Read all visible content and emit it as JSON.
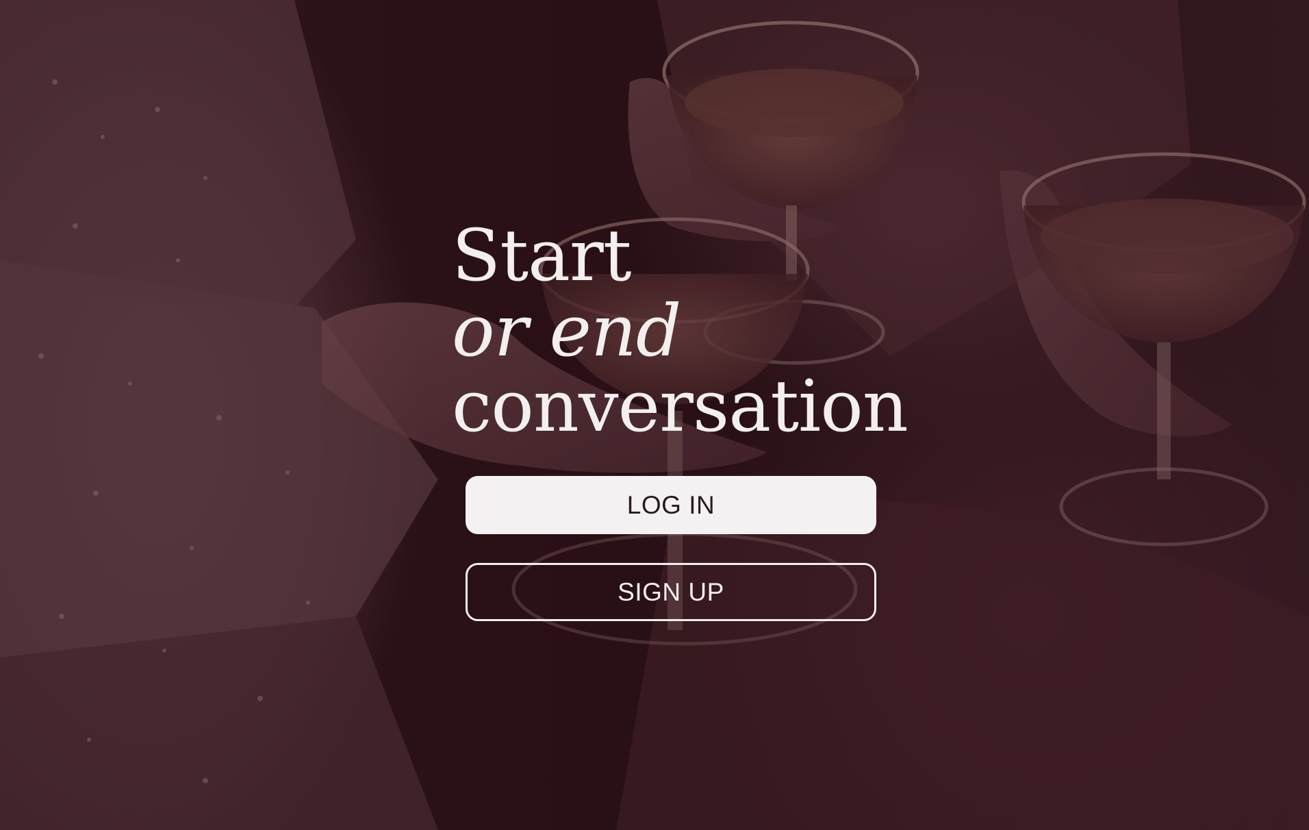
{
  "headline": {
    "line1": "Start",
    "line2": "or end",
    "line3": "conversation"
  },
  "actions": {
    "login_label": "LOG IN",
    "signup_label": "SIGN UP"
  },
  "colors": {
    "overlay_tint": "#2a1418",
    "text_light": "#f4efef",
    "login_button_bg": "#f4f1f2",
    "login_button_text": "#2a1a1d"
  },
  "background": {
    "icon": "champagne-toast-photo"
  }
}
